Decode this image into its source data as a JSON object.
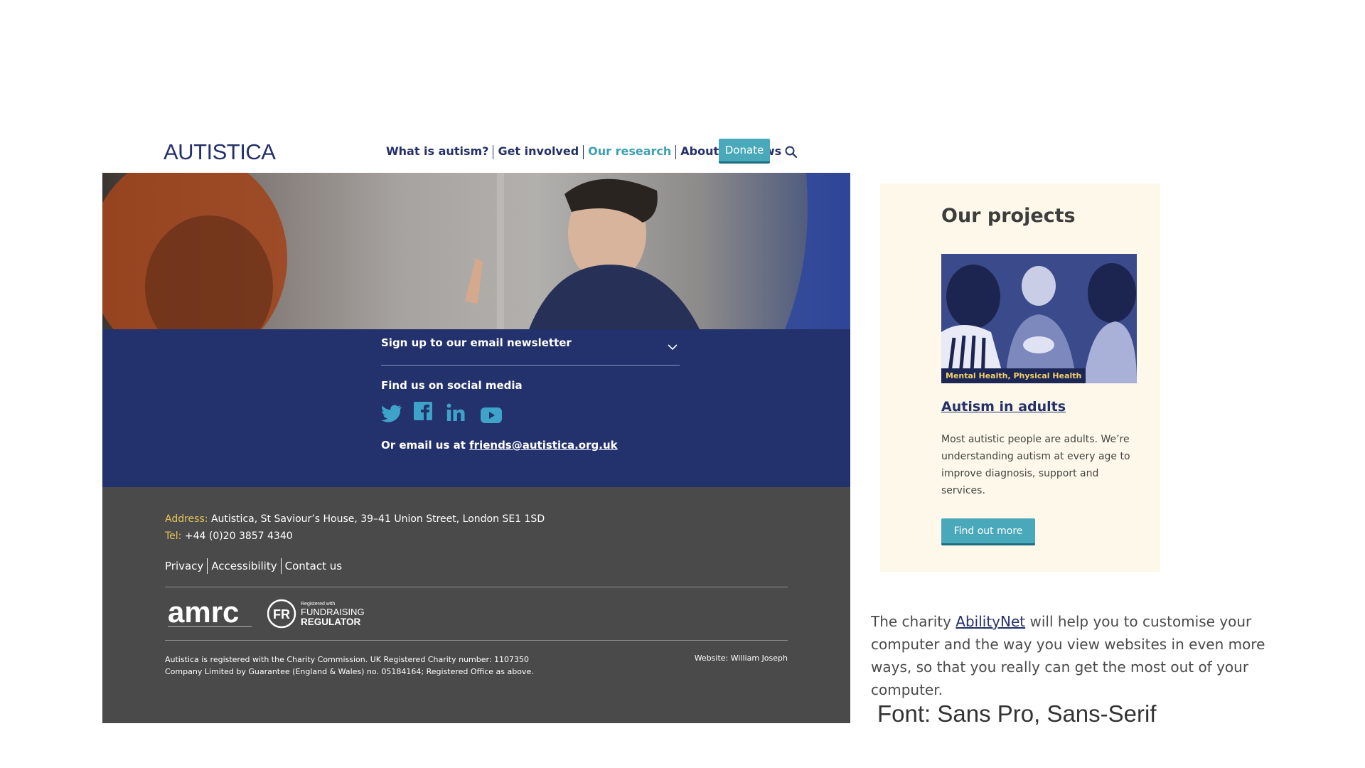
{
  "header": {
    "logo": "AUTISTICA",
    "nav": [
      {
        "label": "What is autism?",
        "active": false
      },
      {
        "label": "Get involved",
        "active": false
      },
      {
        "label": "Our research",
        "active": true
      },
      {
        "label": "About us",
        "active": false
      },
      {
        "label": "News",
        "active": false
      }
    ],
    "donate_label": "Donate",
    "search_icon": "search-icon"
  },
  "newsletter": {
    "label": "Sign up to our email newsletter",
    "social_title": "Find us on social media",
    "social_icons": [
      "twitter-icon",
      "facebook-icon",
      "linkedin-icon",
      "youtube-icon"
    ],
    "email_prefix": "Or email us at ",
    "email": "friends@autistica.org.uk"
  },
  "footer": {
    "address_label": "Address:",
    "address": "Autistica, St Saviour’s House, 39–41 Union Street, London SE1 1SD",
    "tel_label": "Tel:",
    "tel": "+44 (0)20 3857 4340",
    "links": [
      "Privacy",
      "Accessibility",
      "Contact us"
    ],
    "amrc_logo": "amrc",
    "fr_logo_top": "Registered with",
    "fr_logo_mid": "FUNDRAISING",
    "fr_logo_bottom": "REGULATOR",
    "registration_1": "Autistica is registered with the Charity Commission. UK Registered Charity number: 1107350",
    "registration_2": "Company Limited by Guarantee (England & Wales) no. 05184164; Registered Office as above.",
    "website": "Website: William Joseph"
  },
  "projects": {
    "title": "Our projects",
    "tag": "Mental Health, Physical Health",
    "link": "Autism in adults",
    "description": "Most autistic people are adults. We’re understanding autism at every age to improve diagnosis, support and services.",
    "button": "Find out more"
  },
  "ability": {
    "prefix": "The charity ",
    "link": "AbilityNet",
    "suffix": " will help you to customise your computer and the way you view websites in even more ways, so that you really can get the most out of your computer."
  },
  "font_note": "Font: Sans Pro, Sans-Serif",
  "colors": {
    "navy": "#23316c",
    "teal": "#49a9bb",
    "footer_grey": "#4a4a4a",
    "accent_yellow": "#e6c45c",
    "card_bg": "#fdf8e9"
  }
}
